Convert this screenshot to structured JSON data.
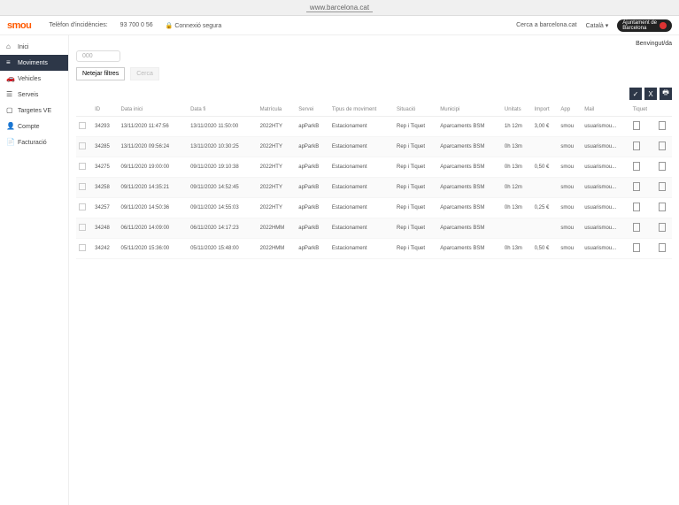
{
  "addr": {
    "url": "www.barcelona.cat"
  },
  "brand": "smou",
  "topbar": {
    "helpline_label": "Telèfon d'incidències:",
    "helpline_number": "93 700 0 56",
    "secure": "Connexió segura",
    "search_placeholder": "Cerca a barcelona.cat",
    "lang": "Català"
  },
  "badge": {
    "line1": "Ajuntament de",
    "line2": "Barcelona"
  },
  "greeting": "Benvingut/da",
  "sidebar": {
    "items": [
      {
        "icon": "⌂",
        "label": "Inici"
      },
      {
        "icon": "≡",
        "label": "Moviments"
      },
      {
        "icon": "🚗",
        "label": "Vehicles"
      },
      {
        "icon": "☰",
        "label": "Serveis"
      },
      {
        "icon": "▢",
        "label": "Targetes VE"
      },
      {
        "icon": "👤",
        "label": "Compte"
      },
      {
        "icon": "📄",
        "label": "Facturació"
      }
    ]
  },
  "search_value": "000",
  "filters": {
    "apply": "Netejar filtres",
    "reset": "Cerca"
  },
  "actions": {
    "check": "✓",
    "excel": "X",
    "print": "🖶"
  },
  "columns": [
    "",
    "ID",
    "Data inici",
    "Data fi",
    "Matrícula",
    "Servei",
    "Tipus de moviment",
    "Situació",
    "Municipi",
    "Unitats",
    "Import",
    "App",
    "Mail",
    "Tiquet",
    ""
  ],
  "rows": [
    {
      "id": "34293",
      "data_inici": "13/11/2020 11:47:56",
      "data_fi": "13/11/2020 11:50:00",
      "matricula": "2022HTY",
      "servei": "apParkB",
      "tipus": "Estacionament",
      "situacio": "Rep i Tiquet",
      "municipi": "Aparcaments BSM",
      "unitats": "1h 12m",
      "import": "3,00 €",
      "app": "smou",
      "mail": "usuarismou..."
    },
    {
      "id": "34285",
      "data_inici": "13/11/2020 09:56:24",
      "data_fi": "13/11/2020 10:30:25",
      "matricula": "2022HTY",
      "servei": "apParkB",
      "tipus": "Estacionament",
      "situacio": "Rep i Tiquet",
      "municipi": "Aparcaments BSM",
      "unitats": "0h 13m",
      "import": "",
      "app": "smou",
      "mail": "usuarismou..."
    },
    {
      "id": "34275",
      "data_inici": "09/11/2020 19:00:00",
      "data_fi": "09/11/2020 19:10:38",
      "matricula": "2022HTY",
      "servei": "apParkB",
      "tipus": "Estacionament",
      "situacio": "Rep i Tiquet",
      "municipi": "Aparcaments BSM",
      "unitats": "0h 13m",
      "import": "0,50 €",
      "app": "smou",
      "mail": "usuarismou..."
    },
    {
      "id": "34258",
      "data_inici": "09/11/2020 14:35:21",
      "data_fi": "09/11/2020 14:52:45",
      "matricula": "2022HTY",
      "servei": "apParkB",
      "tipus": "Estacionament",
      "situacio": "Rep i Tiquet",
      "municipi": "Aparcaments BSM",
      "unitats": "0h 12m",
      "import": "",
      "app": "smou",
      "mail": "usuarismou..."
    },
    {
      "id": "34257",
      "data_inici": "09/11/2020 14:50:36",
      "data_fi": "09/11/2020 14:55:03",
      "matricula": "2022HTY",
      "servei": "apParkB",
      "tipus": "Estacionament",
      "situacio": "Rep i Tiquet",
      "municipi": "Aparcaments BSM",
      "unitats": "0h 13m",
      "import": "0,25 €",
      "app": "smou",
      "mail": "usuarismou..."
    },
    {
      "id": "34248",
      "data_inici": "06/11/2020 14:09:00",
      "data_fi": "06/11/2020 14:17:23",
      "matricula": "2022HMM",
      "servei": "apParkB",
      "tipus": "Estacionament",
      "situacio": "Rep i Tiquet",
      "municipi": "Aparcaments BSM",
      "unitats": "",
      "import": "",
      "app": "smou",
      "mail": "usuarismou..."
    },
    {
      "id": "34242",
      "data_inici": "05/11/2020 15:36:00",
      "data_fi": "05/11/2020 15:48:00",
      "matricula": "2022HMM",
      "servei": "apParkB",
      "tipus": "Estacionament",
      "situacio": "Rep i Tiquet",
      "municipi": "Aparcaments BSM",
      "unitats": "0h 13m",
      "import": "0,50 €",
      "app": "smou",
      "mail": "usuarismou..."
    }
  ]
}
